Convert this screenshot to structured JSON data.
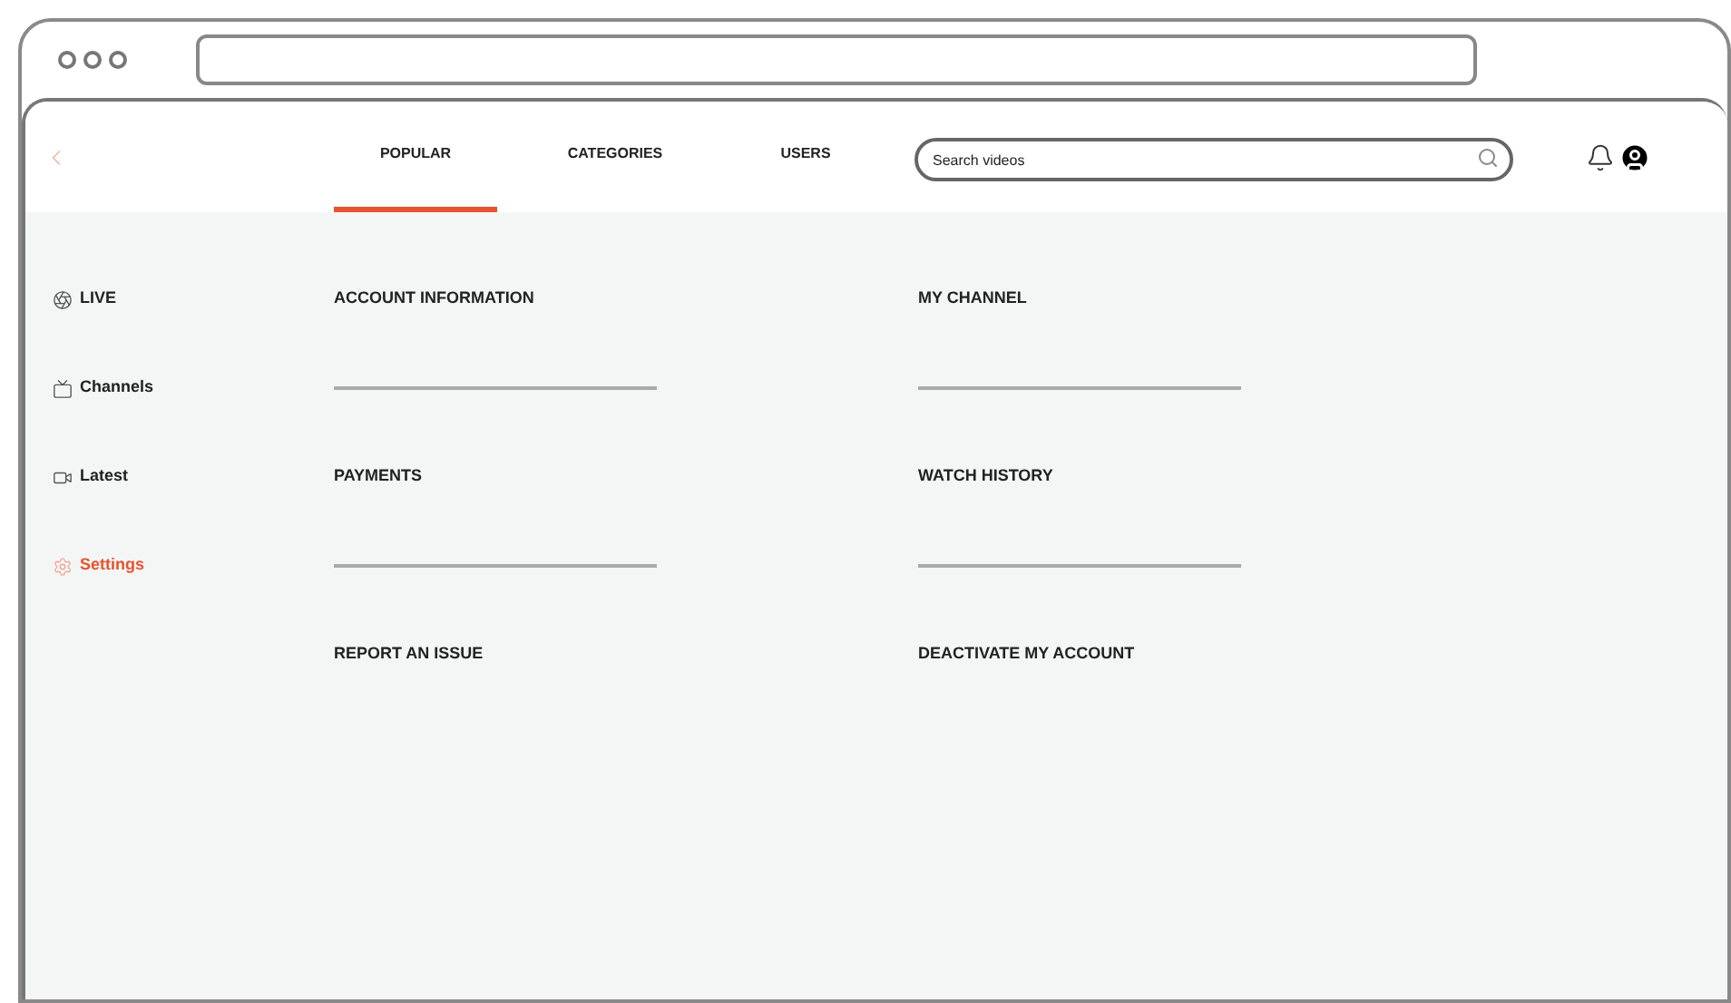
{
  "nav": {
    "tabs": [
      {
        "label": "POPULAR",
        "selected": true
      },
      {
        "label": "CATEGORIES",
        "selected": false
      },
      {
        "label": "USERS",
        "selected": false
      }
    ],
    "search": {
      "placeholder": "Search videos"
    }
  },
  "sidebar": {
    "items": [
      {
        "label": "LIVE",
        "kind": "live",
        "selected": false
      },
      {
        "label": "Channels",
        "kind": "channels",
        "selected": false
      },
      {
        "label": "Latest",
        "kind": "latest",
        "selected": false
      },
      {
        "label": "Settings",
        "kind": "settings",
        "selected": true
      }
    ]
  },
  "settings": {
    "rows": [
      [
        "ACCOUNT INFORMATION",
        "MY CHANNEL"
      ],
      [
        "PAYMENTS",
        "WATCH HISTORY"
      ],
      [
        "REPORT AN ISSUE",
        "DEACTIVATE MY ACCOUNT"
      ]
    ]
  }
}
